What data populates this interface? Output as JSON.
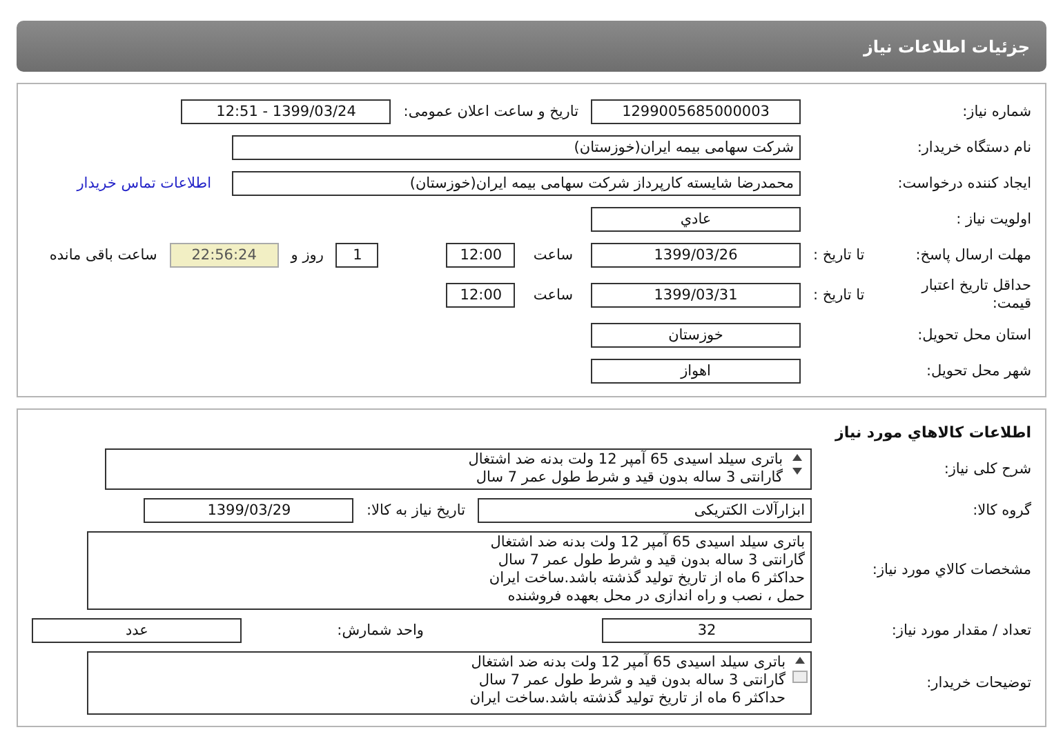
{
  "header": {
    "title": "جزئیات اطلاعات نیاز"
  },
  "need_info": {
    "rows": [
      {
        "label": "شماره نیاز:",
        "items": [
          {
            "kind": "field",
            "text": "1299005685000003"
          },
          {
            "kind": "text",
            "text": "تاریخ و ساعت اعلان عمومی:"
          },
          {
            "kind": "field",
            "text": "1399/03/24 - 12:51"
          }
        ]
      },
      {
        "label": "نام دستگاه خریدار:",
        "items": [
          {
            "kind": "wide_field",
            "text": "شرکت سهامی بیمه ایران(خوزستان)"
          }
        ]
      },
      {
        "label": "ایجاد کننده درخواست:",
        "items": [
          {
            "kind": "wide_field",
            "text": "محمدرضا شایسته کارپرداز شرکت سهامی بیمه ایران(خوزستان)"
          },
          {
            "kind": "link",
            "text": "اطلاعات تماس خریدار"
          }
        ]
      },
      {
        "label": "اولویت نیاز :",
        "items": [
          {
            "kind": "field",
            "text": "عادي"
          }
        ]
      },
      {
        "label": "مهلت ارسال پاسخ:",
        "sublabel": "تا تاریخ :",
        "items": [
          {
            "kind": "field",
            "text": "1399/03/26"
          },
          {
            "kind": "time_label",
            "text": "ساعت"
          },
          {
            "kind": "time_field",
            "text": "12:00"
          },
          {
            "kind": "count_field",
            "text": "1"
          },
          {
            "kind": "text",
            "text": "روز و"
          },
          {
            "kind": "timer",
            "text": "22:56:24"
          },
          {
            "kind": "text",
            "text": "ساعت باقی مانده"
          }
        ]
      },
      {
        "label": "حداقل تاریخ اعتبار قیمت:",
        "sublabel": "تا تاریخ :",
        "items": [
          {
            "kind": "field",
            "text": "1399/03/31"
          },
          {
            "kind": "time_label",
            "text": "ساعت"
          },
          {
            "kind": "time_field",
            "text": "12:00"
          }
        ]
      },
      {
        "label": "استان محل تحویل:",
        "items": [
          {
            "kind": "field",
            "text": "خوزستان"
          }
        ]
      },
      {
        "label": "شهر محل تحویل:",
        "items": [
          {
            "kind": "field",
            "text": "اهواز"
          }
        ]
      }
    ]
  },
  "goods": {
    "title": "اطلاعات کالاهاي مورد نياز",
    "rows": [
      {
        "label": "شرح کلی نیاز:",
        "items": [
          {
            "kind": "scroll_box",
            "text": "باتری سیلد اسیدی 65 آمپر 12 ولت بدنه ضد اشتغال\nگارانتی 3 ساله بدون قید و شرط طول عمر 7 سال"
          }
        ]
      },
      {
        "label": "گروه کالا:",
        "items": [
          {
            "kind": "medium_field",
            "text": "ابزارآلات الکتریکی"
          },
          {
            "kind": "text",
            "text": "تاریخ نیاز به کالا:"
          },
          {
            "kind": "field",
            "text": "1399/03/29"
          }
        ]
      },
      {
        "label": "مشخصات کالاي مورد نياز:",
        "items": [
          {
            "kind": "memo",
            "text": "باتری سیلد اسیدی 65 آمپر 12 ولت بدنه ضد اشتغال\nگارانتی 3 ساله بدون قید و شرط طول عمر 7 سال\nحداکثر 6 ماه از تاریخ تولید گذشته باشد.ساخت ایران\nحمل ، نصب و راه اندازی در محل بعهده فروشنده"
          }
        ]
      },
      {
        "label": "تعداد / مقدار مورد نیاز:",
        "items": [
          {
            "kind": "field",
            "text": "32"
          },
          {
            "kind": "spaced_text",
            "text": "واحد شمارش:"
          },
          {
            "kind": "field",
            "text": "عدد"
          }
        ]
      },
      {
        "label": "توضیحات خریدار:",
        "items": [
          {
            "kind": "notes_box",
            "text": "باتری سیلد اسیدی 65 آمپر 12 ولت بدنه ضد اشتغال\nگارانتی 3 ساله بدون قید و شرط طول عمر 7 سال\nحداکثر 6 ماه از تاریخ تولید گذشته باشد.ساخت ایران"
          }
        ]
      }
    ]
  }
}
